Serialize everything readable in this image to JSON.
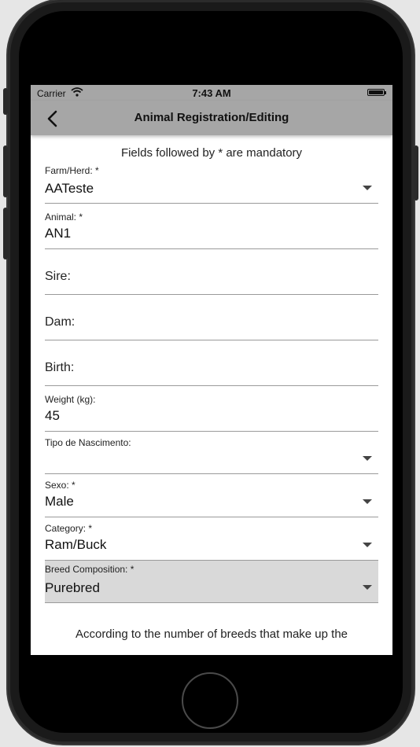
{
  "status_bar": {
    "carrier": "Carrier",
    "time": "7:43 AM"
  },
  "nav": {
    "title": "Animal Registration/Editing"
  },
  "form": {
    "mandatory_note": "Fields followed by * are mandatory",
    "farm": {
      "label": "Farm/Herd: *",
      "value": "AATeste"
    },
    "animal": {
      "label": "Animal: *",
      "value": "AN1"
    },
    "sire": {
      "label": "Sire:"
    },
    "dam": {
      "label": "Dam:"
    },
    "birth": {
      "label": "Birth:"
    },
    "weight": {
      "label": "Weight (kg):",
      "value": "45"
    },
    "birth_type": {
      "label": "Tipo de Nascimento:",
      "value": ""
    },
    "sex": {
      "label": "Sexo:  *",
      "value": "Male"
    },
    "category": {
      "label": "Category:  *",
      "value": "Ram/Buck"
    },
    "breed_composition": {
      "label": "Breed Composition:  *",
      "value": "Purebred"
    }
  },
  "footer": {
    "text": "According to the number of breeds that make up the"
  },
  "icons": {
    "wifi": "wifi-icon",
    "battery": "battery-icon",
    "back": "chevron-left-icon",
    "dropdown": "caret-down-icon"
  }
}
